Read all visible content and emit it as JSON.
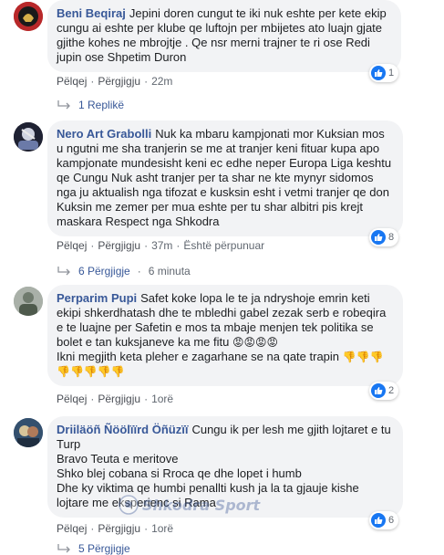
{
  "comments": [
    {
      "author": "Beni Beqiraj",
      "text": "Jepini doren cungut te iki nuk eshte per kete ekip cungu ai eshte per klube qe luftojn per mbijetes ato luajn gjate gjithe kohes ne mbrojtje . Qe nsr merni trajner te ri ose Redi jupin ose Shpetim Duron",
      "reactions": "1",
      "like": "Pëlqej",
      "reply": "Përgjigju",
      "time": "22m",
      "edited": "",
      "replies_label": "1 Replikë",
      "replies_time": ""
    },
    {
      "author": "Nero Art Grabolli",
      "text": "Nuk ka mbaru kampjonati mor Kuksian mos u ngutni me sha tranjerin se me at tranjer keni fituar kupa apo kampjonate mundesisht keni ec edhe neper Europa Liga keshtu qe Cungu Nuk asht tranjer per ta shar ne kte mynyr sidomos nga ju aktualish nga tifozat e kusksin esht i vetmi tranjer qe don Kuksin me zemer per mua eshte per tu shar albitri pis krejt maskara Respect nga Shkodra",
      "reactions": "8",
      "like": "Pëlqej",
      "reply": "Përgjigju",
      "time": "37m",
      "edited": "Është përpunuar",
      "replies_label": "6 Përgjigje",
      "replies_time": "6 minuta"
    },
    {
      "author": "Perparim Pupi",
      "text": "Safet koke lopa le te ja ndryshoje emrin keti ekipi shkerdhatash dhe te mbledhi gabel zezak serb e robeqira e te luajne per Safetin e mos ta mbaje menjen tek politika se bolet e tan kuksjaneve ka me fitu",
      "emoji_line1": "😡😡😡😡",
      "text2": "Ikni megjith keta pleher e zagarhane se na qate trapin",
      "emoji_line2": "👎👎👎👎👎👎👎👎",
      "reactions": "2",
      "like": "Pëlqej",
      "reply": "Përgjigju",
      "time": "1orë"
    },
    {
      "author": "Driiläöñ Ñöölïïrd Öñüzïï",
      "text": "Cungu ik per lesh me gjith lojtaret e tu Turp",
      "text2": "Bravo Teuta e meritove",
      "text3": "Shko blej cobana si Rroca qe dhe lopet i humb",
      "text4": "Dhe ky viktima qe humbi penallti kush ja la ta gjauje kishe lojtare me eksperienc si Rama",
      "reactions": "6",
      "like": "Pëlqej",
      "reply": "Përgjigju",
      "time": "1orë",
      "replies_label": "5 Përgjigje"
    }
  ],
  "watermark": {
    "text": "Shkodra Sport"
  },
  "colors": {
    "link": "#385898",
    "bubble": "#f2f3f5",
    "like": "#1877f2",
    "meta": "#606770"
  }
}
